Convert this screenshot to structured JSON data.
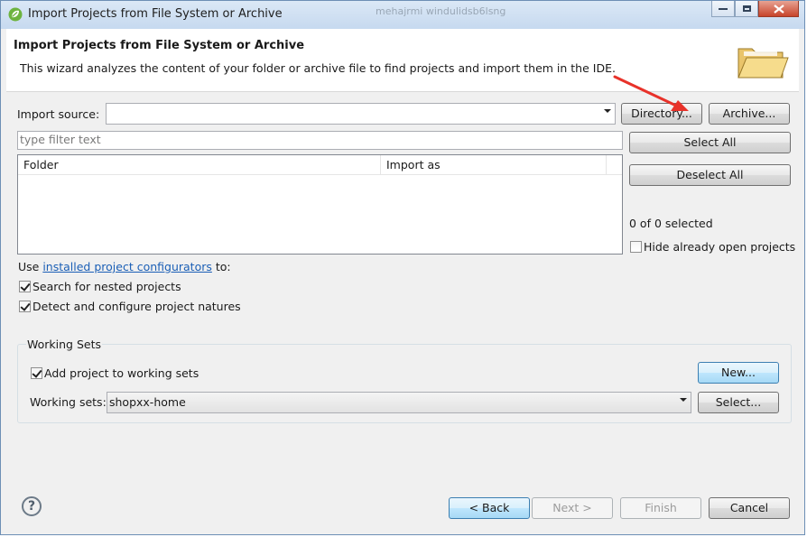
{
  "window": {
    "title": "Import Projects from File System or Archive",
    "blurred_text": "mehajrmi windulidsb6lsng"
  },
  "header": {
    "title": "Import Projects from File System or Archive",
    "description": "This wizard analyzes the content of your folder or archive file to find projects and import them in the IDE."
  },
  "import_source": {
    "label": "Import source:",
    "value": "",
    "directory_button": "Directory...",
    "archive_button": "Archive..."
  },
  "filter": {
    "placeholder": "type filter text"
  },
  "table": {
    "columns": [
      "Folder",
      "Import as"
    ],
    "rows": []
  },
  "side": {
    "select_all": "Select All",
    "deselect_all": "Deselect All",
    "selected_count": "0 of 0 selected",
    "hide_open": {
      "label": "Hide already open projects",
      "checked": false
    }
  },
  "configurators": {
    "prefix": "Use ",
    "link": "installed project configurators",
    "suffix": " to:"
  },
  "options": [
    {
      "label": "Search for nested projects",
      "checked": true
    },
    {
      "label": "Detect and configure project natures",
      "checked": true
    }
  ],
  "working_sets": {
    "group_label": "Working Sets",
    "add_to_sets": {
      "label": "Add project to working sets",
      "checked": true
    },
    "new_button": "New...",
    "sets_label": "Working sets:",
    "sets_value": "shopxx-home",
    "select_button": "Select..."
  },
  "footer": {
    "back": "< Back",
    "next": "Next >",
    "finish": "Finish",
    "cancel": "Cancel"
  },
  "colors": {
    "link": "#1b5fb6",
    "annotation_arrow": "#e8322a",
    "default_button": "#3c7fb1"
  }
}
